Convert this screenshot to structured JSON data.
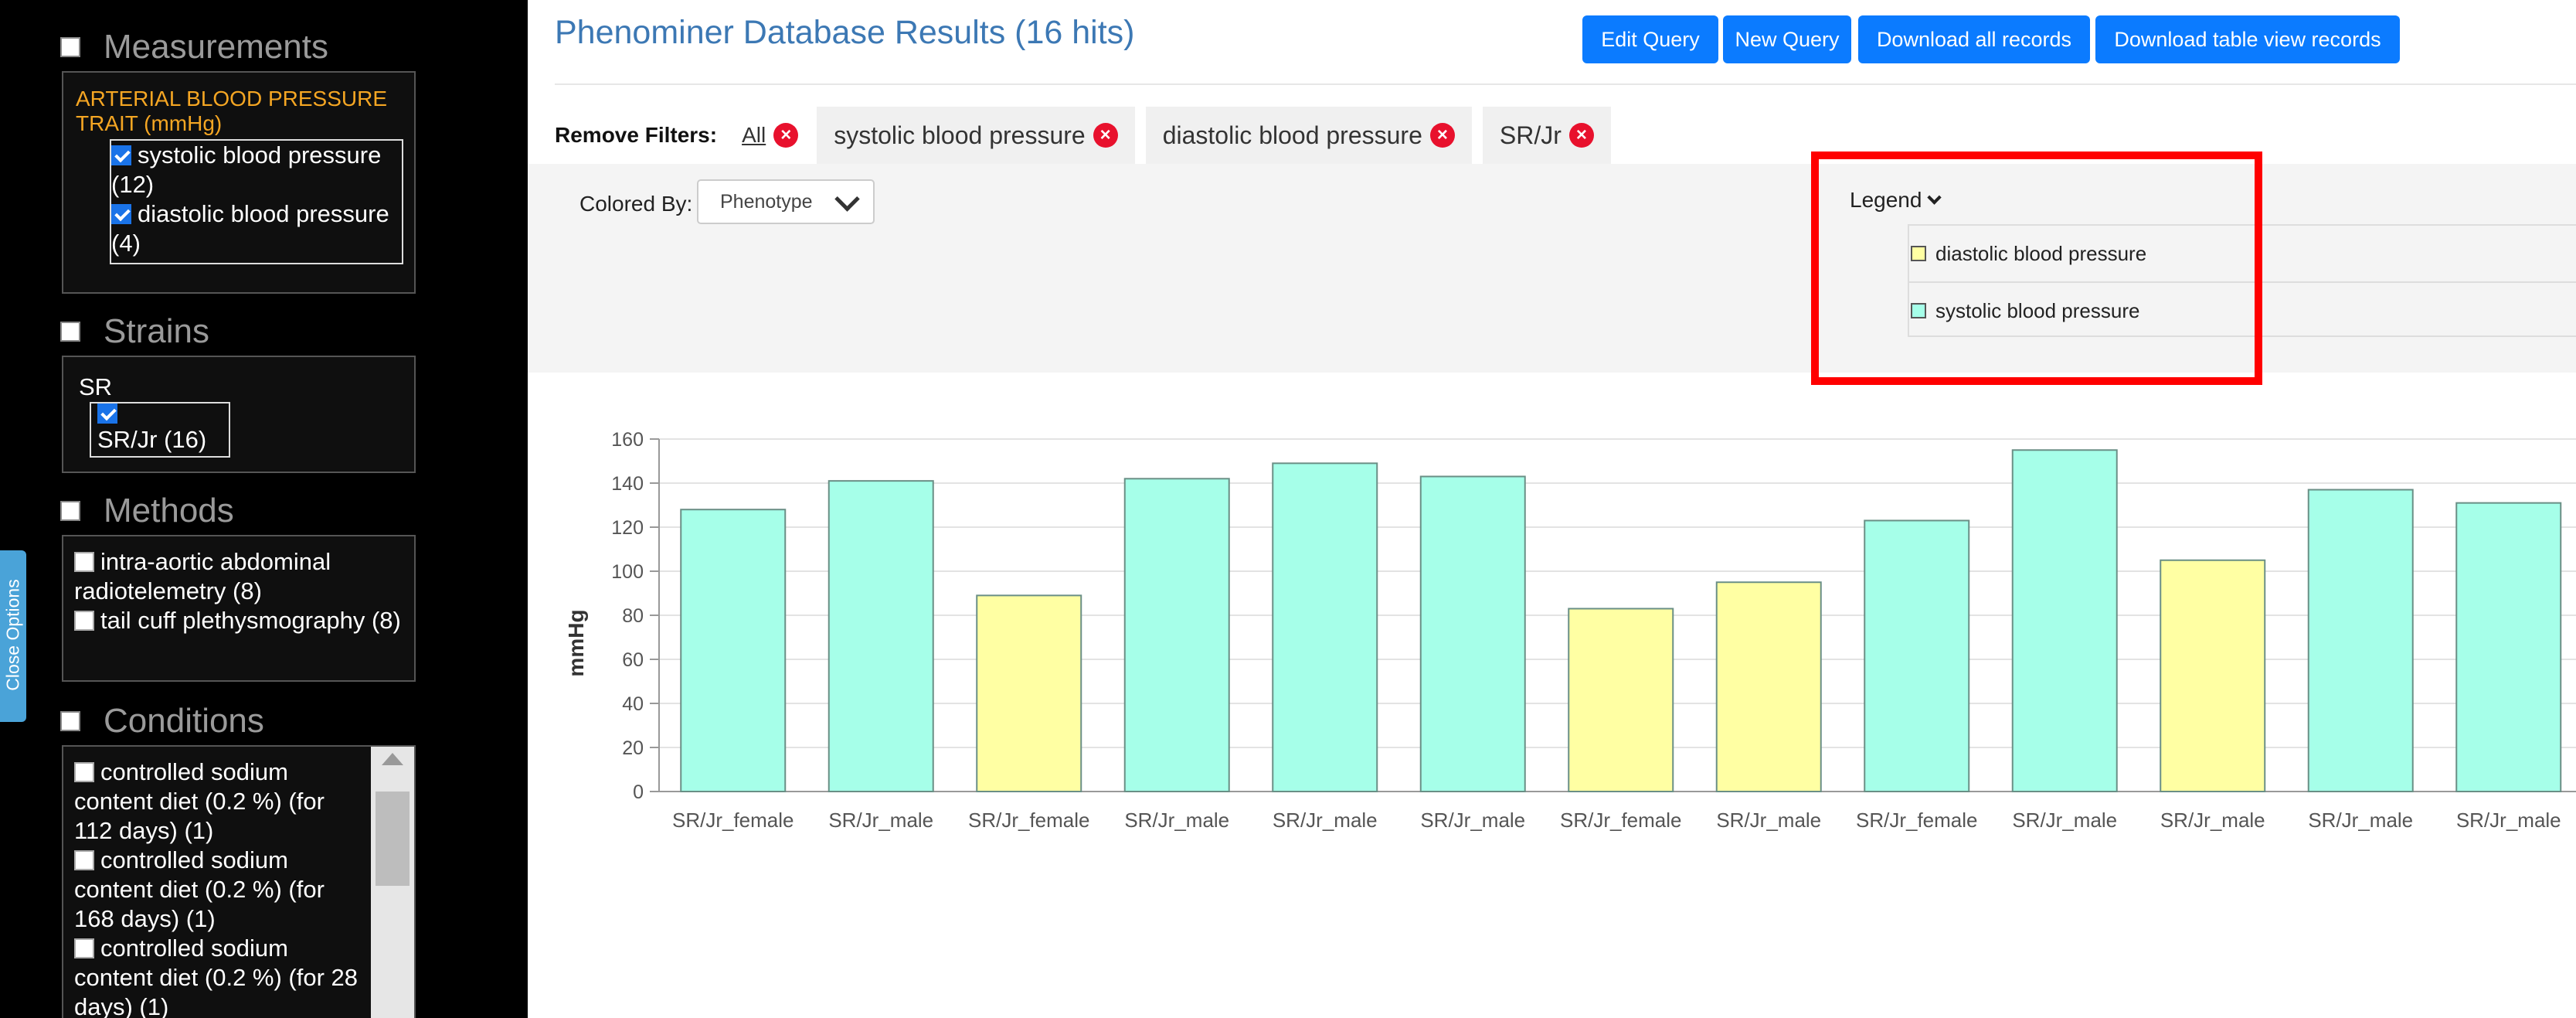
{
  "page": {
    "title": "Phenominer Database Results (16 hits)",
    "buttons": {
      "edit_query": "Edit Query",
      "new_query": "New Query",
      "download_all": "Download all records",
      "download_table": "Download table view records"
    }
  },
  "filters": {
    "label": "Remove Filters:",
    "all": "All",
    "chips": [
      "systolic blood pressure",
      "diastolic blood pressure",
      "SR/Jr"
    ]
  },
  "options": {
    "colored_by_label": "Colored By:",
    "colored_by_value": "Phenotype"
  },
  "legend": {
    "title": "Legend",
    "items": [
      {
        "label": "diastolic blood pressure",
        "color": "#ffffa3"
      },
      {
        "label": "systolic blood pressure",
        "color": "#a6ffe9"
      }
    ]
  },
  "sidebar": {
    "measurements": {
      "title": "Measurements",
      "trait": "ARTERIAL BLOOD PRESSURE TRAIT (mmHg)",
      "items": [
        {
          "label": "systolic blood pressure (12)",
          "checked": true
        },
        {
          "label": "diastolic blood pressure (4)",
          "checked": true
        }
      ]
    },
    "strains": {
      "title": "Strains",
      "group": "SR",
      "items": [
        {
          "label": "SR/Jr (16)",
          "checked": true
        }
      ]
    },
    "methods": {
      "title": "Methods",
      "items": [
        {
          "label": "intra-aortic abdominal radiotelemetry (8)",
          "checked": false
        },
        {
          "label": "tail cuff plethysmography (8)",
          "checked": false
        }
      ]
    },
    "conditions": {
      "title": "Conditions",
      "items": [
        {
          "label": "controlled sodium content diet (0.2 %) (for 112 days)  (1)",
          "checked": false
        },
        {
          "label": "controlled sodium content diet (0.2 %) (for 168 days)  (1)",
          "checked": false
        },
        {
          "label": "controlled sodium content diet (0.2 %) (for 28 days)  (1)",
          "checked": false
        }
      ]
    },
    "close_tab": "Close Options"
  },
  "chart_data": {
    "type": "bar",
    "ylabel": "mmHg",
    "ylim": [
      0,
      160
    ],
    "yticks": [
      0,
      20,
      40,
      60,
      80,
      100,
      120,
      140,
      160
    ],
    "grid": true,
    "categories": [
      "SR/Jr_female",
      "SR/Jr_male",
      "SR/Jr_female",
      "SR/Jr_male",
      "SR/Jr_male",
      "SR/Jr_male",
      "SR/Jr_female",
      "SR/Jr_male",
      "SR/Jr_female",
      "SR/Jr_male",
      "SR/Jr_male",
      "SR/Jr_male",
      "SR/Jr_male"
    ],
    "values": [
      128,
      141,
      89,
      142,
      149,
      143,
      83,
      95,
      123,
      155,
      105,
      137,
      131
    ],
    "phenotypes": [
      "systolic blood pressure",
      "systolic blood pressure",
      "diastolic blood pressure",
      "systolic blood pressure",
      "systolic blood pressure",
      "systolic blood pressure",
      "diastolic blood pressure",
      "diastolic blood pressure",
      "systolic blood pressure",
      "systolic blood pressure",
      "diastolic blood pressure",
      "systolic blood pressure",
      "systolic blood pressure"
    ]
  }
}
